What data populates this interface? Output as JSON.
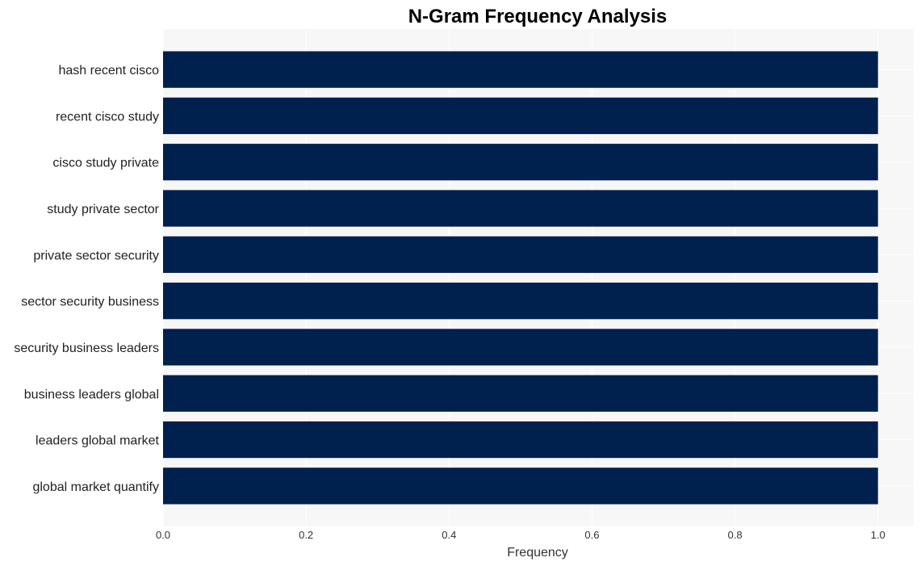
{
  "chart_data": {
    "type": "bar",
    "orientation": "horizontal",
    "title": "N-Gram Frequency Analysis",
    "xlabel": "Frequency",
    "ylabel": "",
    "categories": [
      "hash recent cisco",
      "recent cisco study",
      "cisco study private",
      "study private sector",
      "private sector security",
      "sector security business",
      "security business leaders",
      "business leaders global",
      "leaders global market",
      "global market quantify"
    ],
    "values": [
      1,
      1,
      1,
      1,
      1,
      1,
      1,
      1,
      1,
      1
    ],
    "xlim": [
      0,
      1.05
    ],
    "xticks": [
      "0.0",
      "0.2",
      "0.4",
      "0.6",
      "0.8",
      "1.0"
    ],
    "xtick_values": [
      0,
      0.2,
      0.4,
      0.6,
      0.8,
      1.0
    ],
    "grid": true,
    "legend": "none",
    "colors": {
      "bar": "#00204e",
      "plot_bg": "#f7f7f7",
      "grid": "#ffffff"
    }
  }
}
